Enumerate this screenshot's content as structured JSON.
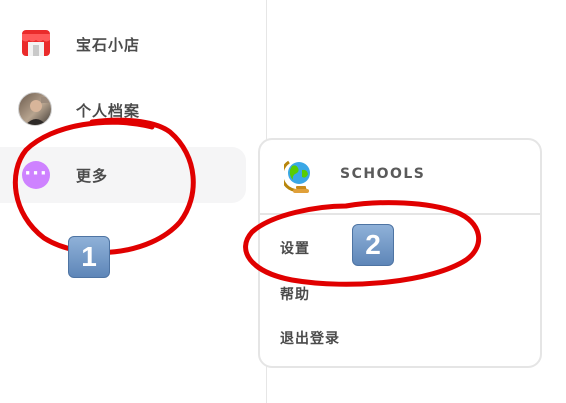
{
  "sidebar": {
    "items": [
      {
        "label": "宝石小店",
        "icon": "shop-icon"
      },
      {
        "label": "个人档案",
        "icon": "avatar"
      },
      {
        "label": "更多",
        "icon": "more-icon",
        "icon_glyph": "···"
      }
    ]
  },
  "popup": {
    "header": {
      "label": "SCHOOLS",
      "icon": "globe-icon"
    },
    "menu": [
      {
        "label": "设置"
      },
      {
        "label": "帮助"
      },
      {
        "label": "退出登录"
      }
    ]
  },
  "annotations": {
    "badge_1": "1",
    "badge_2": "2",
    "circle_color": "#e00000",
    "badge_color": "#6a93c6"
  },
  "colors": {
    "more_icon": "#ce82ff",
    "active_item_bg": "#f5f5f6",
    "border": "#e5e5e5"
  }
}
